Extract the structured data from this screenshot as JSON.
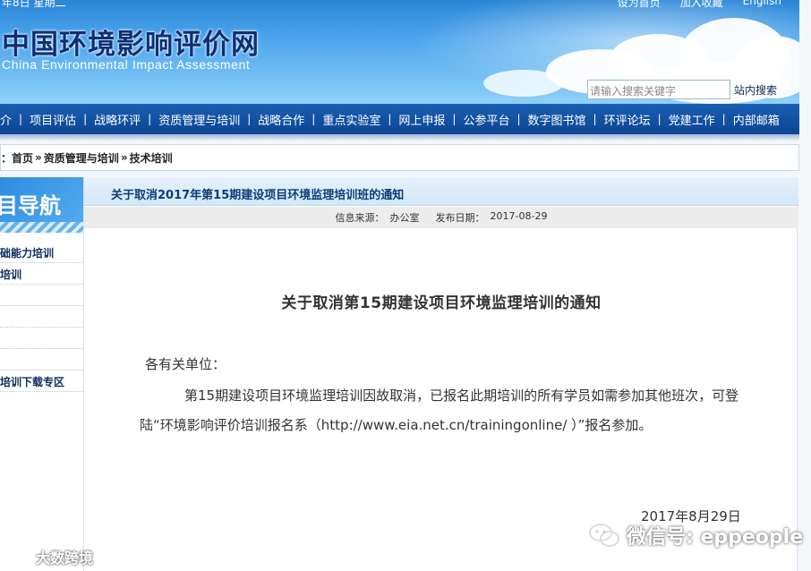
{
  "header": {
    "top_left_text": "年8日 星期二",
    "top_links": [
      "设为首页",
      "加入收藏",
      "English"
    ],
    "logo_cn": "中国环境影响评价网",
    "logo_en": "China Environmental Impact Assessment",
    "search_placeholder": "请输入搜索关键字",
    "search_button": "站内搜索"
  },
  "nav": {
    "items": [
      "介",
      "项目评估",
      "战略环评",
      "资质管理与培训",
      "战略合作",
      "重点实验室",
      "网上申报",
      "公参平台",
      "数字图书馆",
      "环评论坛",
      "党建工作",
      "内部邮箱"
    ]
  },
  "breadcrumb": {
    "prefix": "：",
    "items": [
      "首页",
      "资质管理与培训",
      "技术培训"
    ],
    "separator": "»"
  },
  "sidebar": {
    "title": "目导航",
    "items": [
      "础能力培训",
      "培训",
      "培训下载专区"
    ]
  },
  "article": {
    "header_title": "关于取消2017年第15期建设项目环境监理培训班的通知",
    "source_label": "信息来源：",
    "source_value": "办公室",
    "date_label": "发布日期：",
    "date_value": "2017-08-29",
    "title": "关于取消第15期建设项目环境监理培训的通知",
    "salutation": "各有关单位：",
    "body": "第15期建设项目环境监理培训因故取消，已报名此期培训的所有学员如需参加其他班次，可登陆“环境影响评价培训报名系（http://www.eia.net.cn/trainingonline/ ）”报名参加。",
    "sign_date": "2017年8月29日"
  },
  "watermarks": {
    "left": "大数跨境",
    "right": "微信号: eppeople"
  }
}
